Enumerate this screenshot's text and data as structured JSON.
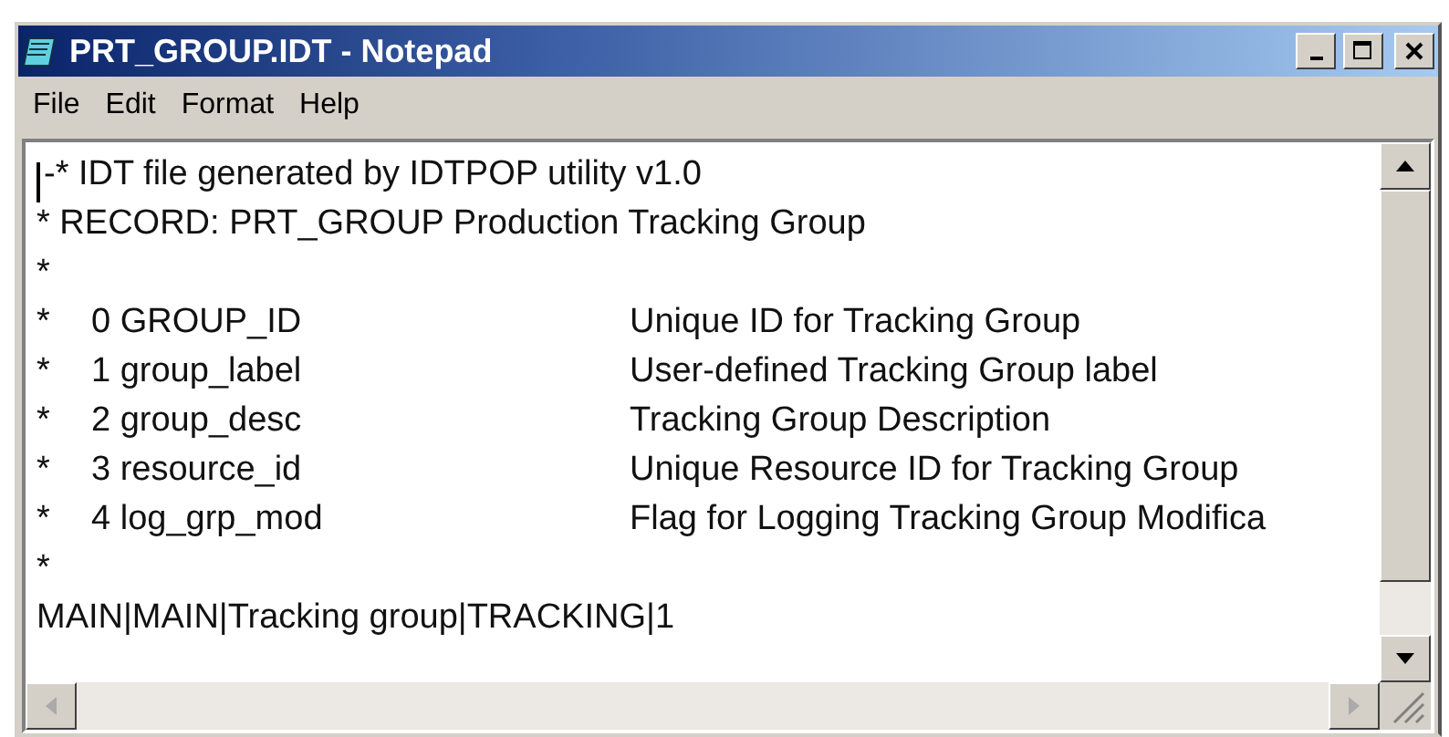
{
  "window": {
    "title": "PRT_GROUP.IDT - Notepad"
  },
  "menu": [
    {
      "label": "File"
    },
    {
      "label": "Edit"
    },
    {
      "label": "Format"
    },
    {
      "label": "Help"
    }
  ],
  "editor": {
    "caret": true,
    "lines": [
      {
        "kind": "text",
        "text": "-* IDT file generated by IDTPOP utility v1.0"
      },
      {
        "kind": "text",
        "text": "* RECORD: PRT_GROUP Production Tracking Group"
      },
      {
        "kind": "text",
        "text": "*"
      },
      {
        "kind": "field",
        "mark": "*",
        "name": "0 GROUP_ID",
        "description": "Unique ID for Tracking Group"
      },
      {
        "kind": "field",
        "mark": "*",
        "name": "1 group_label",
        "description": "User-defined Tracking Group label"
      },
      {
        "kind": "field",
        "mark": "*",
        "name": "2 group_desc",
        "description": "Tracking Group Description"
      },
      {
        "kind": "field",
        "mark": "*",
        "name": "3 resource_id",
        "description": "Unique Resource ID for Tracking Group"
      },
      {
        "kind": "field",
        "mark": "*",
        "name": "4 log_grp_mod",
        "description": "Flag for Logging Tracking Group Modifica"
      },
      {
        "kind": "text",
        "text": "*"
      },
      {
        "kind": "text",
        "text": "MAIN|MAIN|Tracking group|TRACKING|1"
      }
    ]
  }
}
